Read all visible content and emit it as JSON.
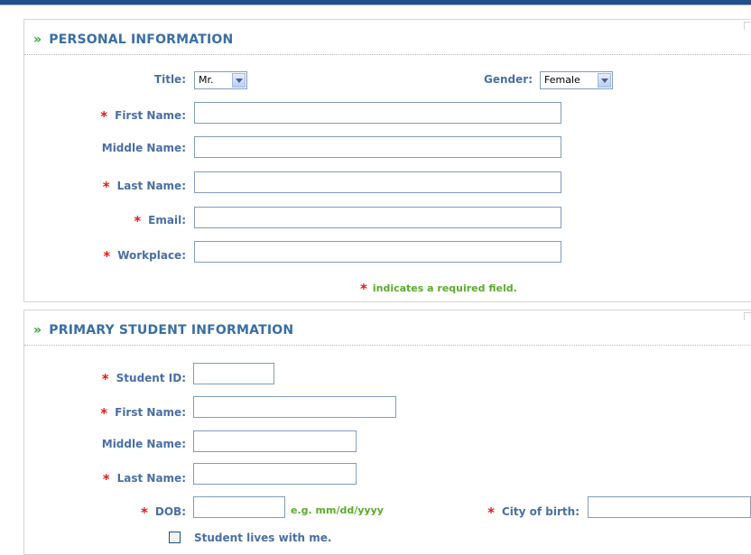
{
  "personal": {
    "heading": "PERSONAL INFORMATION",
    "title_label": "Title:",
    "title_value": "Mr.",
    "gender_label": "Gender:",
    "gender_value": "Female",
    "first_name_label": "First Name:",
    "middle_name_label": "Middle Name:",
    "last_name_label": "Last Name:",
    "email_label": "Email:",
    "workplace_label": "Workplace:",
    "required_note": "indicates a required field."
  },
  "student": {
    "heading": "PRIMARY STUDENT INFORMATION",
    "student_id_label": "Student ID:",
    "first_name_label": "First Name:",
    "middle_name_label": "Middle Name:",
    "last_name_label": "Last Name:",
    "dob_label": "DOB:",
    "dob_hint": "e.g. mm/dd/yyyy",
    "city_label": "City of birth:",
    "lives_with_label": "Student lives with me."
  },
  "icons": {
    "section_chevron": "»",
    "required": "*"
  },
  "colors": {
    "heading": "#3a6ea5",
    "label": "#4a6fa5",
    "required_star": "#e21a1a",
    "hint": "#5cab2b",
    "topbar": "#1f4f8c"
  }
}
